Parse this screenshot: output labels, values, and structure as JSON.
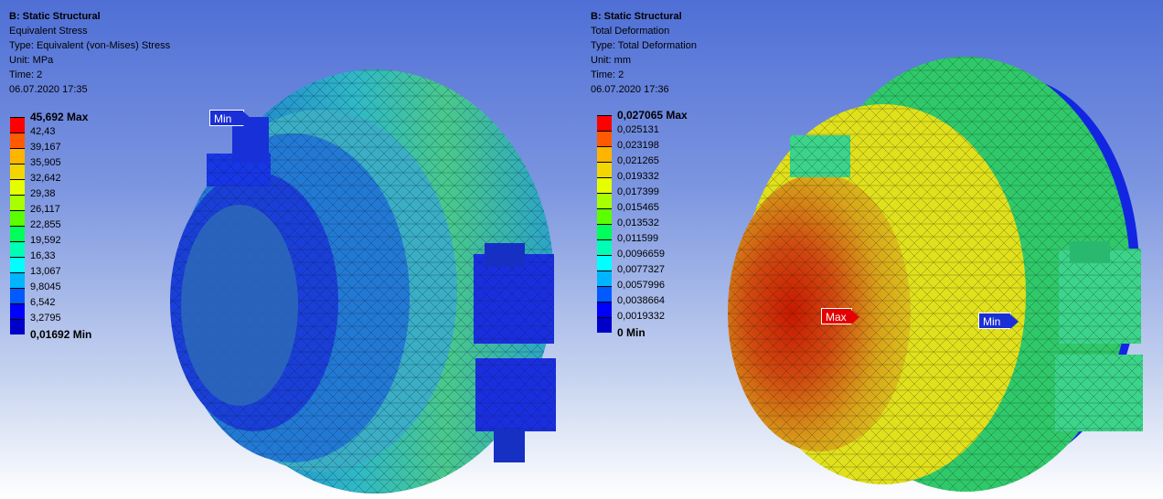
{
  "left": {
    "analysis": "B: Static Structural",
    "result": "Equivalent Stress",
    "type": "Type: Equivalent (von-Mises) Stress",
    "unit": "Unit: MPa",
    "time": "Time: 2",
    "date": "06.07.2020 17:35",
    "legend": [
      "45,692 Max",
      "42,43",
      "39,167",
      "35,905",
      "32,642",
      "29,38",
      "26,117",
      "22,855",
      "19,592",
      "16,33",
      "13,067",
      "9,8045",
      "6,542",
      "3,2795"
    ],
    "legend_min": "0,01692 Min",
    "probe_min": "Min"
  },
  "right": {
    "analysis": "B: Static Structural",
    "result": "Total Deformation",
    "type": "Type: Total Deformation",
    "unit": "Unit: mm",
    "time": "Time: 2",
    "date": "06.07.2020 17:36",
    "legend": [
      "0,027065 Max",
      "0,025131",
      "0,023198",
      "0,021265",
      "0,019332",
      "0,017399",
      "0,015465",
      "0,013532",
      "0,011599",
      "0,0096659",
      "0,0077327",
      "0,0057996",
      "0,0038664",
      "0,0019332"
    ],
    "legend_min": "0 Min",
    "probe_min": "Min",
    "probe_max": "Max"
  },
  "colors": {
    "scale": [
      "#ff0000",
      "#ff5a00",
      "#ffb400",
      "#f2d600",
      "#e6ff00",
      "#a8ff00",
      "#5cff00",
      "#00ff5a",
      "#00ffb4",
      "#00ffff",
      "#00b4ff",
      "#005aff",
      "#0000ff",
      "#0000c8"
    ],
    "bg_top": "#4f6fd6",
    "bg_bottom": "#ffffff"
  }
}
